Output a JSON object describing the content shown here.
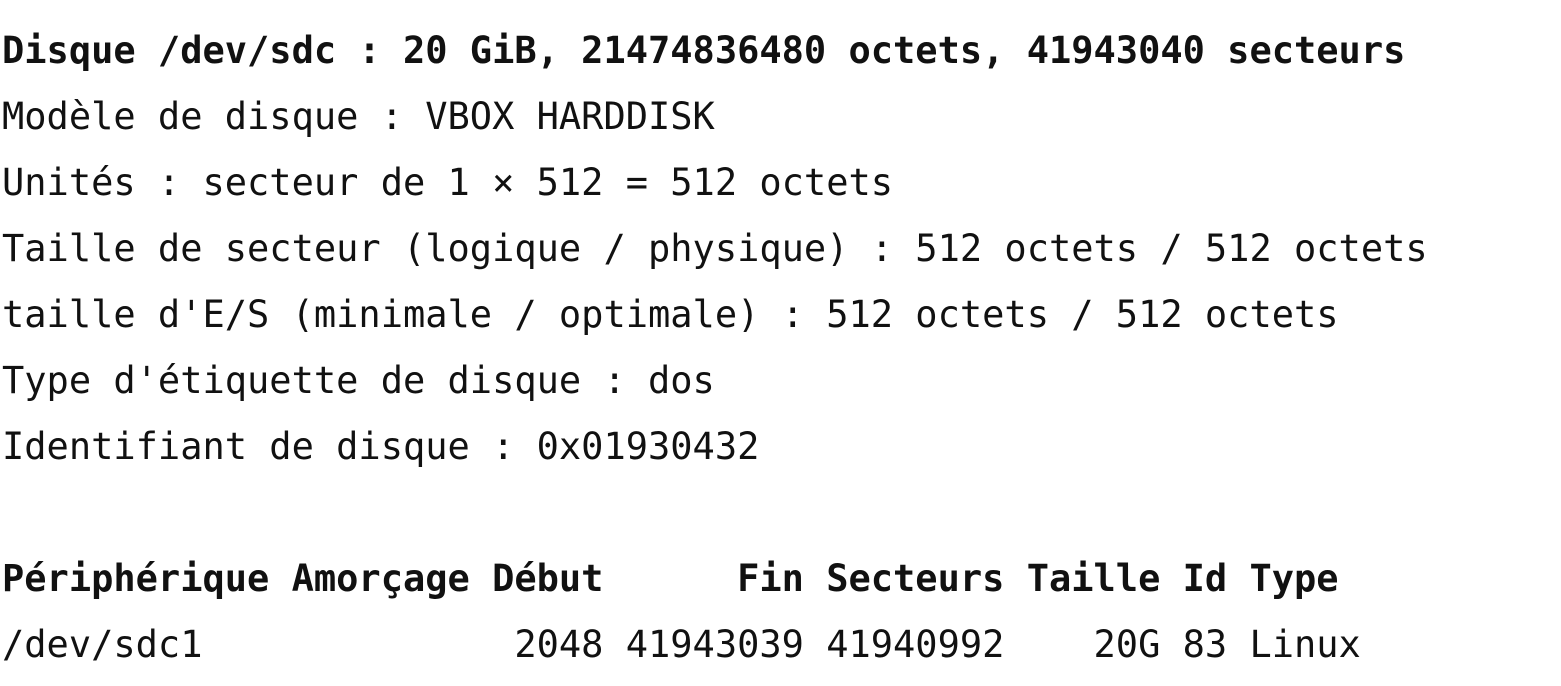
{
  "terminal": {
    "disk_header": "Disque /dev/sdc : 20 GiB, 21474836480 octets, 41943040 secteurs",
    "model": "Modèle de disque : VBOX HARDDISK",
    "units": "Unités : secteur de 1 × 512 = 512 octets",
    "sector_size": "Taille de secteur (logique / physique) : 512 octets / 512 octets",
    "io_size": "taille d'E/S (minimale / optimale) : 512 octets / 512 octets",
    "label_type": "Type d'étiquette de disque : dos",
    "identifier": "Identifiant de disque : 0x01930432",
    "table_header": "Périphérique Amorçage Début      Fin Secteurs Taille Id Type",
    "rows": [
      "/dev/sdc1              2048 41943039 41940992    20G 83 Linux"
    ]
  }
}
